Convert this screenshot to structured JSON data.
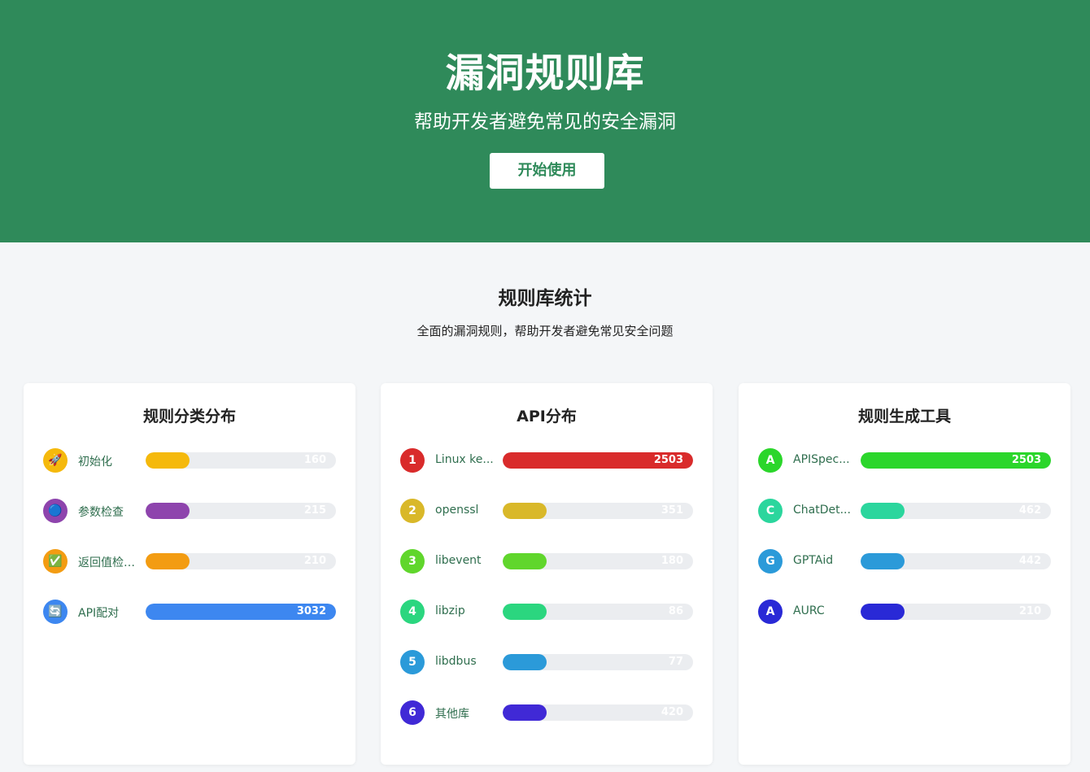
{
  "hero": {
    "title": "漏洞规则库",
    "subtitle": "帮助开发者避免常见的安全漏洞",
    "cta": "开始使用",
    "bg": "#2f8a5a"
  },
  "stats": {
    "title": "规则库统计",
    "desc": "全面的漏洞规则，帮助开发者避免常见安全问题"
  },
  "cards": [
    {
      "title": "规则分类分布",
      "max": 3032,
      "items": [
        {
          "icon": "🚀",
          "icon_name": "rocket-icon",
          "label": "初始化",
          "value": 160,
          "color": "#f5b90c"
        },
        {
          "icon": "🔵",
          "icon_name": "blue-dot-icon",
          "label": "参数检查",
          "value": 215,
          "color": "#8e44ad"
        },
        {
          "icon": "✅",
          "icon_name": "checkmark-icon",
          "label": "返回值检查",
          "display_label": "返回值检…",
          "value": 210,
          "color": "#f39c12"
        },
        {
          "icon": "🔄",
          "icon_name": "refresh-icon",
          "label": "API配对",
          "value": 3032,
          "color": "#3d87f0"
        }
      ]
    },
    {
      "title": "API分布",
      "max": 2503,
      "items": [
        {
          "icon": "1",
          "icon_name": "rank-1-icon",
          "label": "Linux kernel",
          "display_label": "Linux ke...",
          "value": 2503,
          "color": "#d92b2b"
        },
        {
          "icon": "2",
          "icon_name": "rank-2-icon",
          "label": "openssl",
          "value": 351,
          "color": "#d9b829"
        },
        {
          "icon": "3",
          "icon_name": "rank-3-icon",
          "label": "libevent",
          "value": 180,
          "color": "#60d62c"
        },
        {
          "icon": "4",
          "icon_name": "rank-4-icon",
          "label": "libzip",
          "value": 86,
          "color": "#2bd67f"
        },
        {
          "icon": "5",
          "icon_name": "rank-5-icon",
          "label": "libdbus",
          "value": 77,
          "color": "#2b9ad9"
        },
        {
          "icon": "6",
          "icon_name": "rank-6-icon",
          "label": "其他库",
          "value": 420,
          "color": "#4029d6"
        }
      ]
    },
    {
      "title": "规则生成工具",
      "max": 2503,
      "items": [
        {
          "icon": "A",
          "icon_name": "letter-a-icon",
          "label": "APISpecGen",
          "display_label": "APISpec...",
          "value": 2503,
          "color": "#2bd62b"
        },
        {
          "icon": "C",
          "icon_name": "letter-c-icon",
          "label": "ChatDetector",
          "display_label": "ChatDet...",
          "value": 462,
          "color": "#2bd69d"
        },
        {
          "icon": "G",
          "icon_name": "letter-g-icon",
          "label": "GPTAid",
          "value": 442,
          "color": "#2b9ad9"
        },
        {
          "icon": "A",
          "icon_name": "letter-a-icon",
          "label": "AURC",
          "value": 210,
          "color": "#2929d6"
        }
      ]
    }
  ]
}
